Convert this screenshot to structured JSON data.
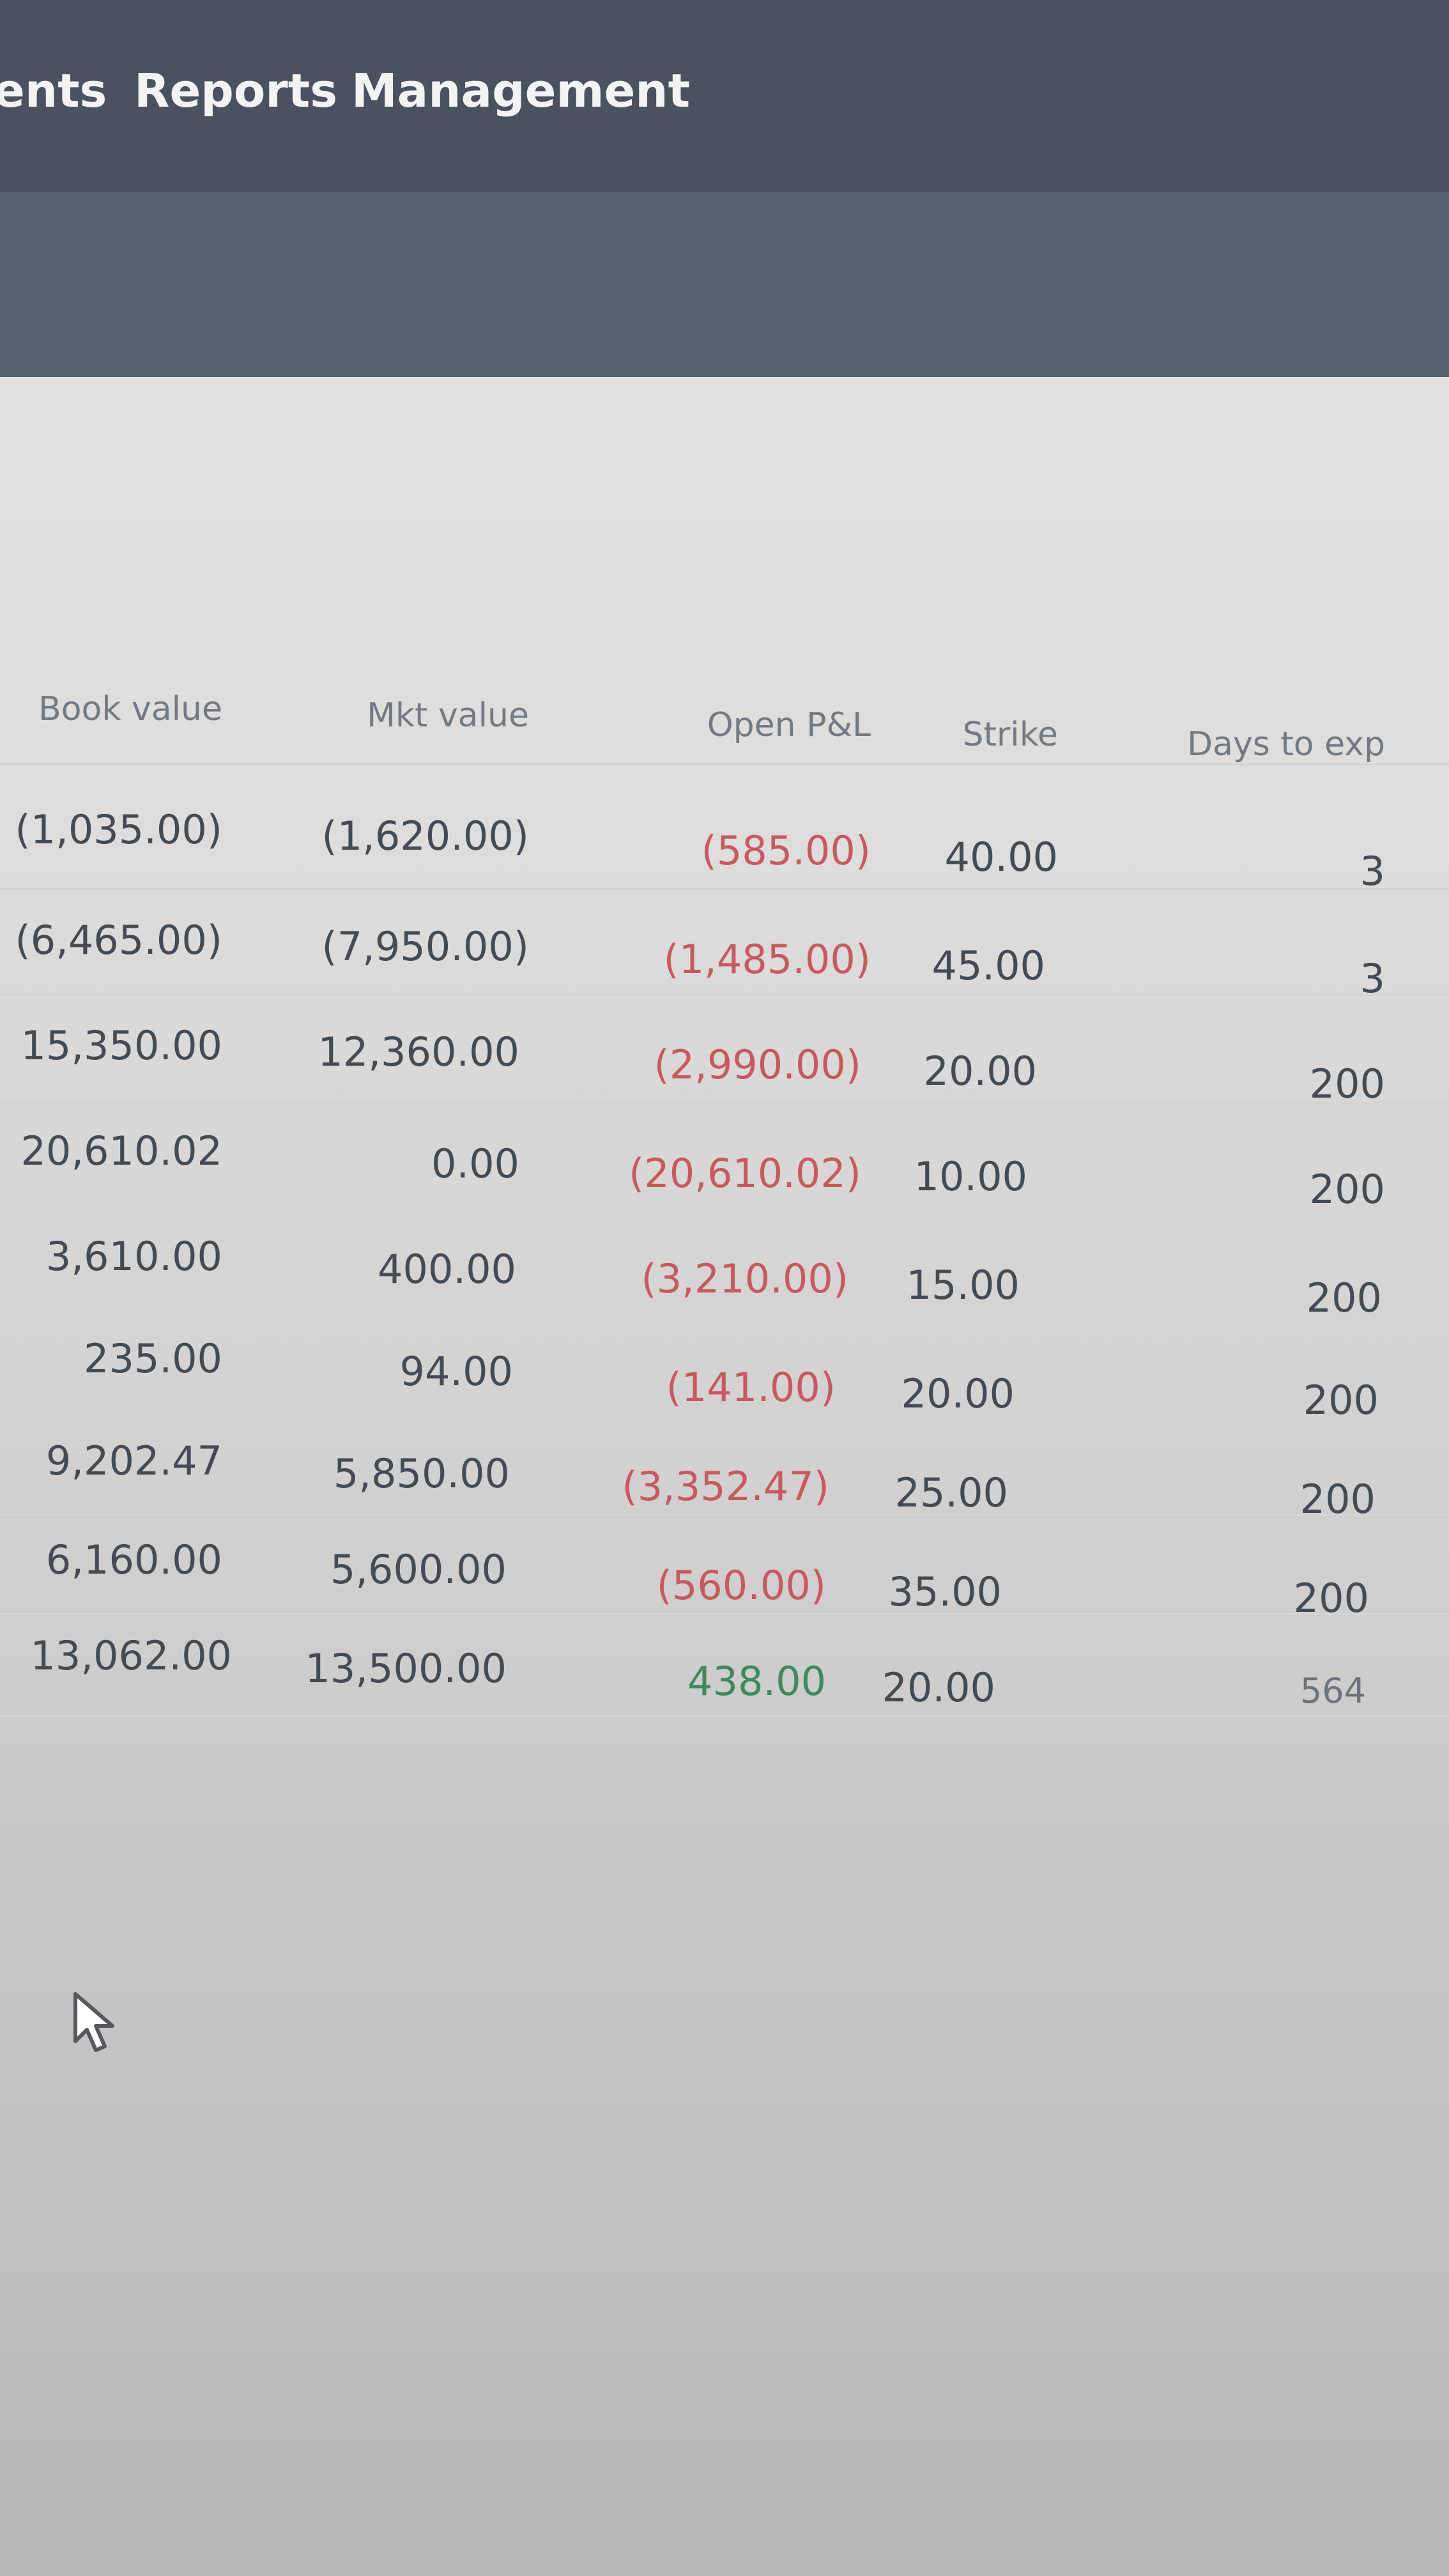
{
  "nav": {
    "items": [
      "ents",
      "Reports",
      "Management"
    ]
  },
  "table": {
    "columns": [
      "Book value",
      "Mkt value",
      "Open P&L",
      "Strike",
      "Days to exp"
    ],
    "rows": [
      {
        "book_value": "(1,035.00)",
        "mkt_value": "(1,620.00)",
        "open_pl": "(585.00)",
        "strike": "40.00",
        "days_to_exp": "3"
      },
      {
        "book_value": "(6,465.00)",
        "mkt_value": "(7,950.00)",
        "open_pl": "(1,485.00)",
        "strike": "45.00",
        "days_to_exp": "3"
      },
      {
        "book_value": "15,350.00",
        "mkt_value": "12,360.00",
        "open_pl": "(2,990.00)",
        "strike": "20.00",
        "days_to_exp": "200"
      },
      {
        "book_value": "20,610.02",
        "mkt_value": "0.00",
        "open_pl": "(20,610.02)",
        "strike": "10.00",
        "days_to_exp": "200"
      },
      {
        "book_value": "3,610.00",
        "mkt_value": "400.00",
        "open_pl": "(3,210.00)",
        "strike": "15.00",
        "days_to_exp": "200"
      },
      {
        "book_value": "235.00",
        "mkt_value": "94.00",
        "open_pl": "(141.00)",
        "strike": "20.00",
        "days_to_exp": "200"
      },
      {
        "book_value": "9,202.47",
        "mkt_value": "5,850.00",
        "open_pl": "(3,352.47)",
        "strike": "25.00",
        "days_to_exp": "200"
      },
      {
        "book_value": "6,160.00",
        "mkt_value": "5,600.00",
        "open_pl": "(560.00)",
        "strike": "35.00",
        "days_to_exp": "200"
      },
      {
        "book_value": "13,062.00",
        "mkt_value": "13,500.00",
        "open_pl": "438.00",
        "strike": "20.00",
        "days_to_exp": "564"
      }
    ]
  },
  "colors": {
    "nav_bg": "#4a5260",
    "subbar_bg": "#57616f",
    "negative": "#c75a5f",
    "positive": "#3d8a5c",
    "text": "#444b54"
  },
  "icons": {
    "cursor": "mouse-pointer-icon"
  }
}
